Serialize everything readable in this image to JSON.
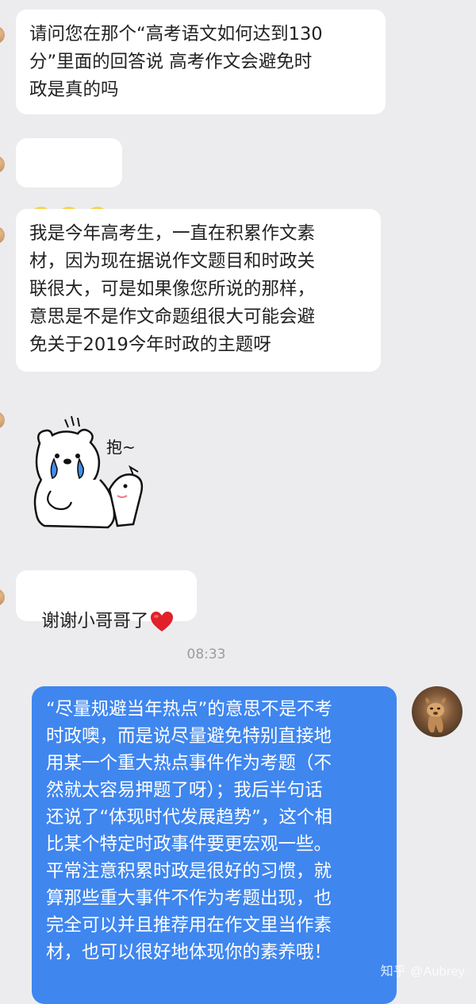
{
  "messages": {
    "m1": "请问您在那个“高考语文如何达到130\n分”里面的回答说 高考作文会避免时\n政是真的吗",
    "m3": "我是今年高考生，一直在积累作文素\n材，因为现在据说作文题目和时政关\n联很大，可是如果像您所说的那样，\n意思是不是作文命题组很大可能会避\n免关于2019今年时政的主题呀",
    "sticker_text": "抱~",
    "m5": "谢谢小哥哥了",
    "time": "08:33",
    "reply": "“尽量规避当年热点”的意思不是不考\n时政噢，而是说尽量避免特别直接地\n用某一个重大热点事件作为考题（不\n然就太容易押题了呀）；我后半句话\n还说了“体现时代发展趋势”，这个相\n比某个特定时政事件要更宏观一些。\n平常注意积累时政是很好的习惯，就\n算那些重大事件不作为考题出现，也\n完全可以并且推荐用在作文里当作素\n材，也可以很好地体现你的素养哦！"
  },
  "icons": {
    "crying_emoji": "crying-face-icon",
    "heart": "red-heart-icon",
    "sticker": "crying-bear-hug-sticker"
  },
  "colors": {
    "background": "#ececee",
    "incoming_bubble": "#ffffff",
    "outgoing_bubble": "#3f86ef",
    "timestamp": "#9a9aa0"
  },
  "watermark": "知乎 @Aubrey"
}
